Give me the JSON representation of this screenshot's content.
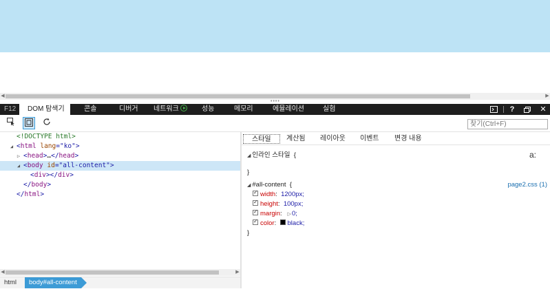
{
  "devtools": {
    "tabs": [
      {
        "label": "F12"
      },
      {
        "label": "DOM 탐색기"
      },
      {
        "label": "콘솔"
      },
      {
        "label": "디버거"
      },
      {
        "label": "네트워크"
      },
      {
        "label": "성능"
      },
      {
        "label": "메모리"
      },
      {
        "label": "에뮬레이션"
      },
      {
        "label": "실험"
      }
    ],
    "active_tab": "DOM 탐색기",
    "window_icons": [
      "console-toggle-icon",
      "help-icon",
      "undock-icon",
      "close-icon"
    ],
    "help_label": "?",
    "close_label": "✕"
  },
  "toolbar": {
    "search_placeholder": "찾기(Ctrl+F)"
  },
  "dom_tree": {
    "doctype": "<!DOCTYPE html>",
    "html_open_tag": "html",
    "html_lang_attr": "lang",
    "html_lang_value": "\"ko\"",
    "head_text": "head",
    "head_collapsed": "…",
    "body_tag": "body",
    "body_id_attr": "id",
    "body_id_value": "\"all-content\"",
    "div_tag": "div",
    "body_close": "body",
    "html_close": "html"
  },
  "breadcrumb": {
    "items": [
      "html",
      "body#all-content"
    ]
  },
  "styles": {
    "subtabs": [
      "스타일",
      "계산됨",
      "레이아웃",
      "이벤트",
      "변경 내용"
    ],
    "active_subtab": "스타일",
    "inline_header": "인라인 스타일",
    "inline_open": "{",
    "inline_close": "}",
    "aa_label": "a:",
    "rule_selector": "#all-content",
    "rule_open": "{",
    "rule_close": "}",
    "rule_source": "page2.css (1)",
    "properties": [
      {
        "name": "width",
        "value": "1200px;"
      },
      {
        "name": "height",
        "value": "100px;"
      },
      {
        "name": "margin",
        "value": "0;"
      },
      {
        "name": "color",
        "value": "black;"
      }
    ]
  },
  "colors": {
    "page_box": "#bde3f5",
    "devtools_bar": "#1e1e1e",
    "accent": "#3c9bd6"
  }
}
